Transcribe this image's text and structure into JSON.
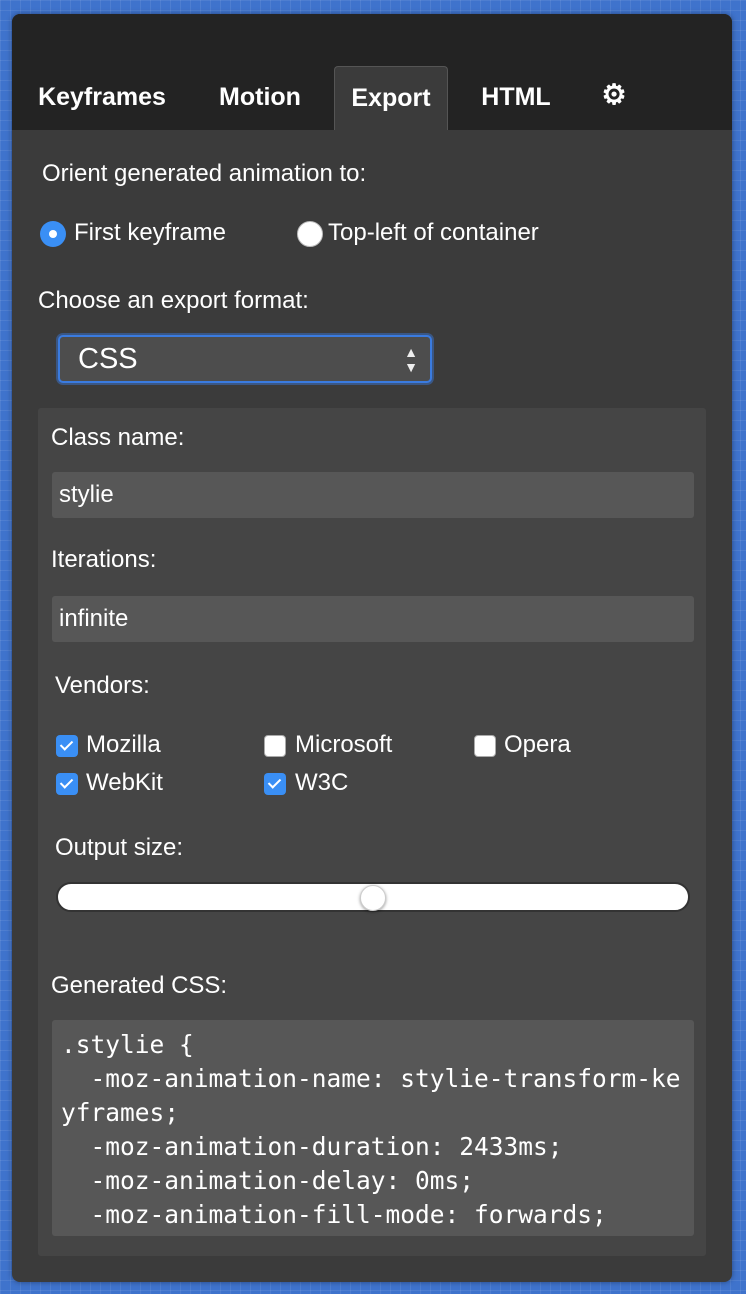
{
  "tabs": [
    {
      "label": "Keyframes",
      "active": false
    },
    {
      "label": "Motion",
      "active": false
    },
    {
      "label": "Export",
      "active": true
    },
    {
      "label": "HTML",
      "active": false
    }
  ],
  "settings_icon": "gear-icon",
  "orient": {
    "label": "Orient generated animation to:",
    "options": [
      {
        "label": "First keyframe",
        "selected": true
      },
      {
        "label": "Top-left of container",
        "selected": false
      }
    ]
  },
  "export_format": {
    "label": "Choose an export format:",
    "selected": "CSS"
  },
  "class_name": {
    "label": "Class name:",
    "value": "stylie"
  },
  "iterations": {
    "label": "Iterations:",
    "value": "infinite"
  },
  "vendors": {
    "label": "Vendors:",
    "items": [
      {
        "label": "Mozilla",
        "checked": true
      },
      {
        "label": "Microsoft",
        "checked": false
      },
      {
        "label": "Opera",
        "checked": false
      },
      {
        "label": "WebKit",
        "checked": true
      },
      {
        "label": "W3C",
        "checked": true
      }
    ]
  },
  "output_size": {
    "label": "Output size:",
    "value_fraction": 0.5
  },
  "generated": {
    "label": "Generated CSS:",
    "code": ".stylie {\n  -moz-animation-name: stylie-transform-keyframes;\n  -moz-animation-duration: 2433ms;\n  -moz-animation-delay: 0ms;\n  -moz-animation-fill-mode: forwards;"
  },
  "colors": {
    "accent": "#3a8ff5",
    "panel": "#3b3b3b",
    "tabbar": "#232323",
    "background": "#3f73cc"
  }
}
